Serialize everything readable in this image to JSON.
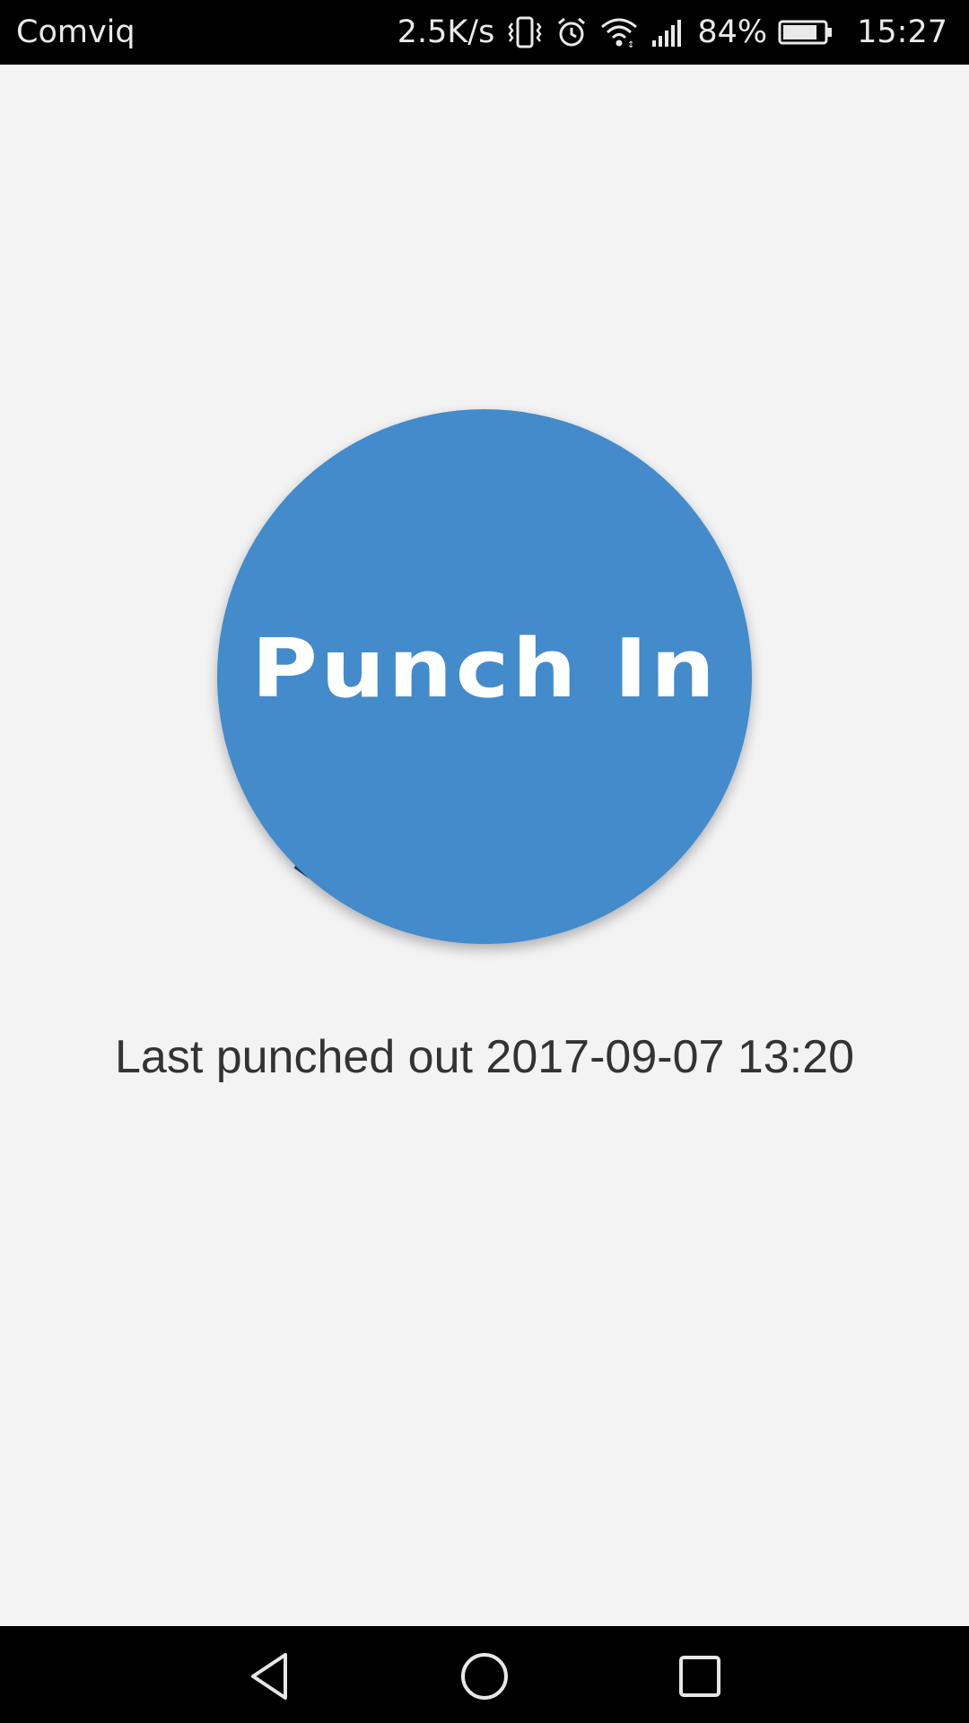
{
  "status_bar": {
    "carrier": "Comviq",
    "net_speed": "2.5K/s",
    "battery_percent": "84%",
    "time": "15:27",
    "icons": [
      "vibrate-icon",
      "alarm-icon",
      "wifi-icon",
      "signal-icon",
      "battery-icon"
    ],
    "battery_level": 0.84
  },
  "main": {
    "punch_button_label": "Punch In",
    "last_punch_text": "Last punched out 2017-09-07 13:20",
    "button_color": "#438bcb",
    "ring_color": "#1f4670",
    "background_color": "#f3f3f4"
  },
  "nav_bar": {
    "icons": [
      "back-icon",
      "home-icon",
      "recent-apps-icon"
    ]
  }
}
